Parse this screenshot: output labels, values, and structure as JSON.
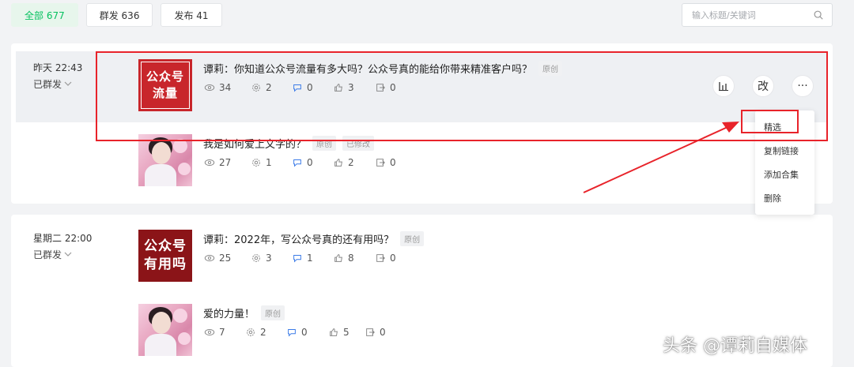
{
  "tabs": [
    {
      "label": "全部 677",
      "active": true
    },
    {
      "label": "群发 636",
      "active": false
    },
    {
      "label": "发布 41",
      "active": false
    }
  ],
  "search": {
    "placeholder": "输入标题/关键词"
  },
  "groups": [
    {
      "time": "昨天 22:43",
      "status": "已群发",
      "articles": [
        {
          "thumb_text": [
            "公众号",
            "流量"
          ],
          "title": "谭莉：你知道公众号流量有多大吗？公众号真的能给你带来精准客户吗？",
          "badges": [
            "原创"
          ],
          "stats": {
            "views": "34",
            "shares": "2",
            "comments": "0",
            "likes": "3",
            "forwards": "0"
          }
        },
        {
          "thumb_text": [],
          "title": "我是如何爱上文字的？",
          "badges": [
            "原创",
            "已修改"
          ],
          "stats": {
            "views": "27",
            "shares": "1",
            "comments": "0",
            "likes": "2",
            "forwards": "0"
          }
        }
      ]
    },
    {
      "time": "星期二 22:00",
      "status": "已群发",
      "articles": [
        {
          "thumb_text": [
            "公众号",
            "有用吗"
          ],
          "title": "谭莉：2022年，写公众号真的还有用吗？",
          "badges": [
            "原创"
          ],
          "stats": {
            "views": "25",
            "shares": "3",
            "comments": "1",
            "likes": "8",
            "forwards": "0"
          }
        },
        {
          "thumb_text": [],
          "title": "爱的力量！",
          "badges": [
            "原创"
          ],
          "stats": {
            "views": "7",
            "shares": "2",
            "comments": "0",
            "likes": "5",
            "forwards": "0"
          }
        }
      ]
    }
  ],
  "actions": {
    "stats_icon": "bar-chart-icon",
    "edit_label": "改",
    "more_label": "···"
  },
  "menu": [
    "精选",
    "复制链接",
    "添加合集",
    "删除"
  ],
  "watermark": "头条 @谭莉自媒体",
  "colors": {
    "accent": "#07c160",
    "highlight": "#e8232a",
    "thumb_red": "#c8262b"
  }
}
